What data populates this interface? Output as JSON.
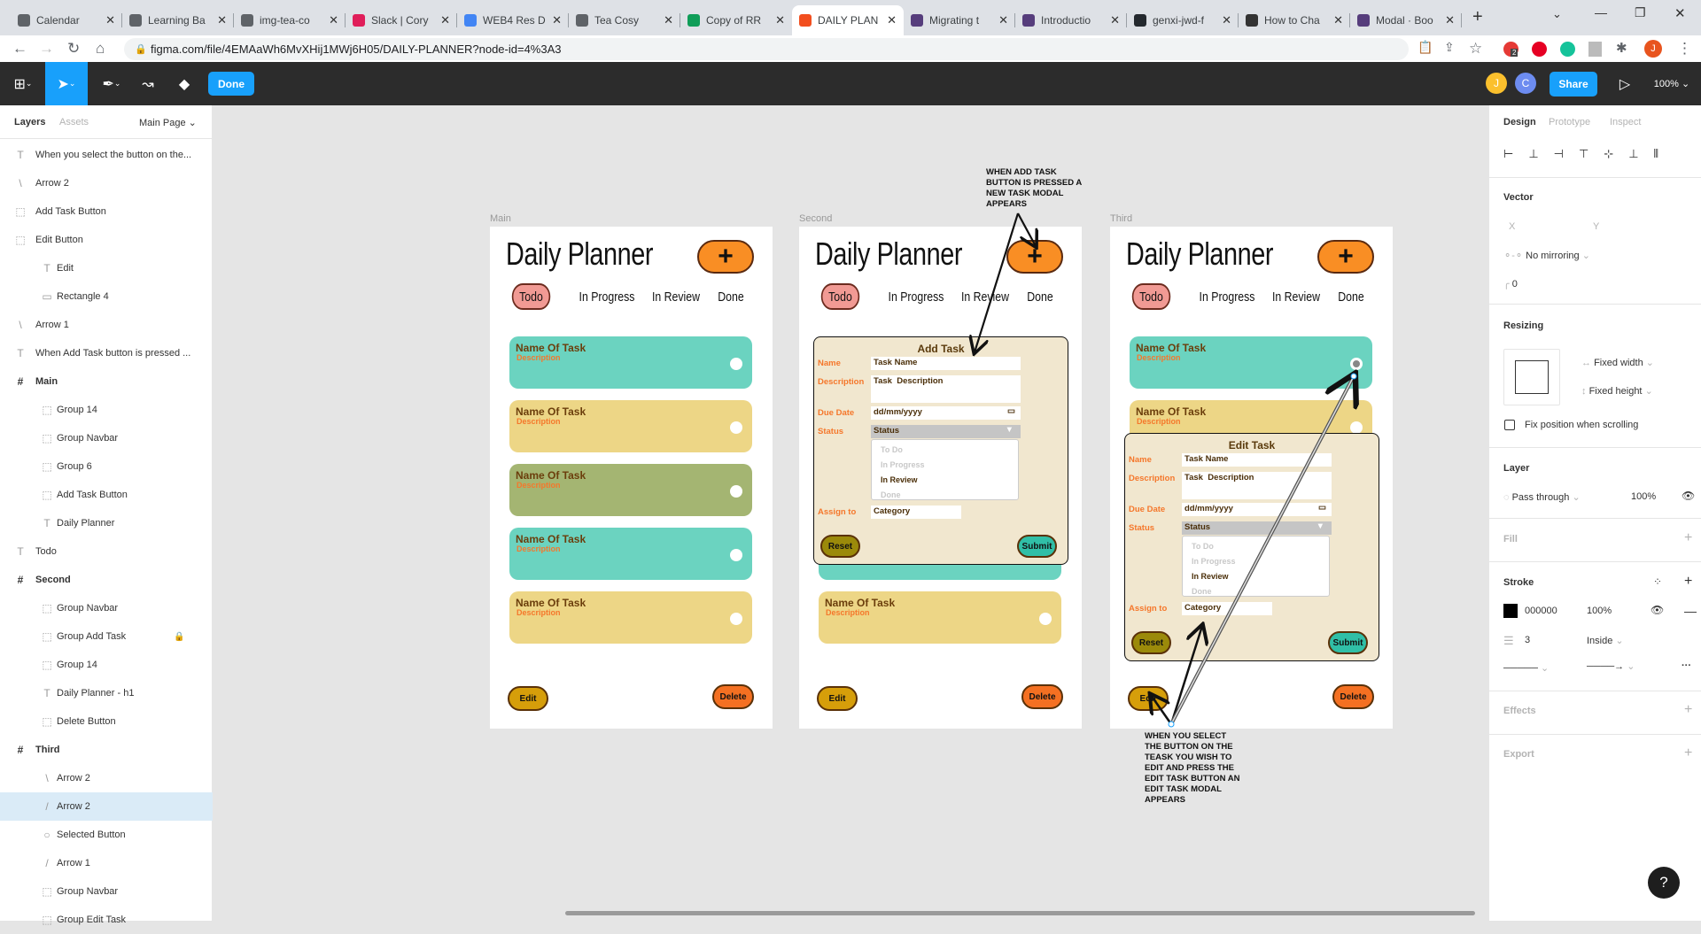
{
  "browser": {
    "tabs": [
      {
        "label": "Calendar",
        "icon": "arrow-icon",
        "color": "#5f6368"
      },
      {
        "label": "Learning Ba",
        "icon": "arrow-icon",
        "color": "#5f6368"
      },
      {
        "label": "img-tea-co",
        "icon": "globe-icon",
        "color": "#5f6368"
      },
      {
        "label": "Slack | Cory",
        "icon": "slack-icon",
        "color": "#e01e5a"
      },
      {
        "label": "WEB4 Res D",
        "icon": "docs-icon",
        "color": "#4285f4"
      },
      {
        "label": "Tea Cosy",
        "icon": "globe-icon",
        "color": "#5f6368"
      },
      {
        "label": "Copy of RR",
        "icon": "sheets-icon",
        "color": "#0f9d58"
      },
      {
        "label": "DAILY PLAN",
        "icon": "figma-icon",
        "color": "#f24e1e"
      },
      {
        "label": "Migrating t",
        "icon": "bootstrap-icon",
        "color": "#563d7c"
      },
      {
        "label": "Introductio",
        "icon": "bootstrap-icon",
        "color": "#563d7c"
      },
      {
        "label": "genxi-jwd-f",
        "icon": "github-icon",
        "color": "#24292e"
      },
      {
        "label": "How to Cha",
        "icon": "site-icon",
        "color": "#333"
      },
      {
        "label": "Modal · Boo",
        "icon": "bootstrap-icon",
        "color": "#563d7c"
      }
    ],
    "url": "figma.com/file/4EMAaWh6MvXHij1MWj6H05/DAILY-PLANNER?node-id=4%3A3",
    "extension_badge": "2",
    "profile_initial": "J"
  },
  "toolbar": {
    "done_label": "Done",
    "avatars": [
      "J",
      "C"
    ],
    "share_label": "Share",
    "zoom": "100%"
  },
  "layers_panel": {
    "tabs": [
      "Layers",
      "Assets"
    ],
    "page": "Main Page",
    "items": [
      {
        "label": "When you select the button on the...",
        "icon": "text",
        "level": 0
      },
      {
        "label": "Arrow 2",
        "icon": "line",
        "level": 0
      },
      {
        "label": "Add Task Button",
        "icon": "group",
        "level": 0
      },
      {
        "label": "Edit Button",
        "icon": "group",
        "level": 0
      },
      {
        "label": "Edit",
        "icon": "text",
        "level": 1
      },
      {
        "label": "Rectangle 4",
        "icon": "rect",
        "level": 1
      },
      {
        "label": "Arrow 1",
        "icon": "line",
        "level": 0
      },
      {
        "label": "When Add Task button is pressed ...",
        "icon": "text",
        "level": 0
      },
      {
        "label": "Main",
        "icon": "frame",
        "level": 0,
        "bold": true
      },
      {
        "label": "Group 14",
        "icon": "group",
        "level": 1
      },
      {
        "label": "Group Navbar",
        "icon": "group",
        "level": 1
      },
      {
        "label": "Group 6",
        "icon": "group",
        "level": 1
      },
      {
        "label": "Add Task Button",
        "icon": "group",
        "level": 1
      },
      {
        "label": "Daily Planner",
        "icon": "text",
        "level": 1
      },
      {
        "label": "Todo",
        "icon": "text",
        "level": 0
      },
      {
        "label": "Second",
        "icon": "frame",
        "level": 0,
        "bold": true
      },
      {
        "label": "Group Navbar",
        "icon": "group",
        "level": 1
      },
      {
        "label": "Group Add Task",
        "icon": "group",
        "level": 1,
        "locked": true
      },
      {
        "label": "Group 14",
        "icon": "group",
        "level": 1
      },
      {
        "label": " Daily Planner - h1",
        "icon": "text",
        "level": 1
      },
      {
        "label": "Delete Button",
        "icon": "group",
        "level": 1
      },
      {
        "label": "Third",
        "icon": "frame",
        "level": 0,
        "bold": true
      },
      {
        "label": "Arrow 2",
        "icon": "line",
        "level": 1
      },
      {
        "label": "Arrow 2",
        "icon": "line2",
        "level": 1,
        "selected": true
      },
      {
        "label": "Selected Button",
        "icon": "ellipse",
        "level": 1
      },
      {
        "label": "Arrow 1",
        "icon": "line2",
        "level": 1
      },
      {
        "label": "Group Navbar",
        "icon": "group",
        "level": 1
      },
      {
        "label": "Group Edit Task",
        "icon": "group",
        "level": 1
      }
    ]
  },
  "design_panel": {
    "tabs": [
      "Design",
      "Prototype",
      "Inspect"
    ],
    "vector": {
      "title": "Vector",
      "x_label": "X",
      "y_label": "Y",
      "mirroring": "No mirroring",
      "corner": "0"
    },
    "resizing": {
      "title": "Resizing",
      "width": "Fixed width",
      "height": "Fixed height",
      "fix_position": "Fix position when scrolling"
    },
    "layer": {
      "title": "Layer",
      "blend": "Pass through",
      "opacity": "100%"
    },
    "fill": {
      "title": "Fill"
    },
    "stroke": {
      "title": "Stroke",
      "color": "000000",
      "opacity": "100%",
      "weight": "3",
      "position": "Inside"
    },
    "effects": {
      "title": "Effects"
    },
    "export": {
      "title": "Export"
    }
  },
  "canvas": {
    "frames": [
      {
        "label": "Main",
        "title": "Daily Planner",
        "plus": "+",
        "nav": [
          "Todo",
          "In Progress",
          "In Review",
          "Done"
        ],
        "cards": [
          {
            "name": "Name Of Task",
            "desc": "Description",
            "color": "#6bd3c0"
          },
          {
            "name": "Name Of Task",
            "desc": "Description",
            "color": "#edd686"
          },
          {
            "name": "Name Of Task",
            "desc": "Description",
            "color": "#a4b572"
          },
          {
            "name": "Name Of Task",
            "desc": "Description",
            "color": "#6bd3c0"
          },
          {
            "name": "Name Of Task",
            "desc": "Description",
            "color": "#edd686"
          }
        ],
        "edit": "Edit",
        "delete": "Delete"
      },
      {
        "label": "Second",
        "title": "Daily Planner",
        "plus": "+",
        "nav": [
          "Todo",
          "In Progress",
          "In Review",
          "Done"
        ],
        "cards": [
          {
            "name": "",
            "desc": "",
            "color": "#6bd3c0"
          },
          {
            "name": "",
            "desc": "",
            "color": "#edd686"
          },
          {
            "name": "",
            "desc": "",
            "color": "#a4b572"
          },
          {
            "name": "",
            "desc": "",
            "color": "#6bd3c0"
          },
          {
            "name": "Name Of Task",
            "desc": "Description",
            "color": "#edd686"
          }
        ],
        "edit": "Edit",
        "delete": "Delete",
        "modal": {
          "title": "Add Task",
          "labels": [
            "Name",
            "Description",
            "Due Date",
            "Status",
            "Assign to"
          ],
          "name": "Task Name",
          "description": "Task  Description",
          "due": "dd/mm/yyyy",
          "status": "Status",
          "options": [
            "To Do",
            "In Progress",
            "In Review",
            "Done"
          ],
          "selected_option": 2,
          "assign": "Category",
          "reset": "Reset",
          "submit": "Submit"
        }
      },
      {
        "label": "Third",
        "title": "Daily Planner",
        "plus": "+",
        "nav": [
          "Todo",
          "In Progress",
          "In Review",
          "Done"
        ],
        "cards": [
          {
            "name": "Name Of Task",
            "desc": "Description",
            "color": "#6bd3c0",
            "selected": true
          },
          {
            "name": "Name Of Task",
            "desc": "Description",
            "color": "#edd686"
          }
        ],
        "edit": "Edit",
        "delete": "Delete",
        "modal": {
          "title": "Edit Task",
          "labels": [
            "Name",
            "Description",
            "Due Date",
            "Status",
            "Assign to"
          ],
          "name": "Task Name",
          "description": "Task  Description",
          "due": "dd/mm/yyyy",
          "status": "Status",
          "options": [
            "To Do",
            "In Progress",
            "In Review",
            "Done"
          ],
          "selected_option": 2,
          "assign": "Category",
          "reset": "Reset",
          "submit": "Submit"
        }
      }
    ],
    "annotations": {
      "add_task": "WHEN ADD TASK\nBUTTON IS PRESSED A\nNEW TASK MODAL\nAPPEARS",
      "edit_task": "WHEN YOU SELECT\nTHE BUTTON ON THE\nTEASK YOU WISH TO\nEDIT AND PRESS THE\nEDIT TASK BUTTON AN\nEDIT TASK MODAL\nAPPEARS"
    },
    "help": "?"
  }
}
